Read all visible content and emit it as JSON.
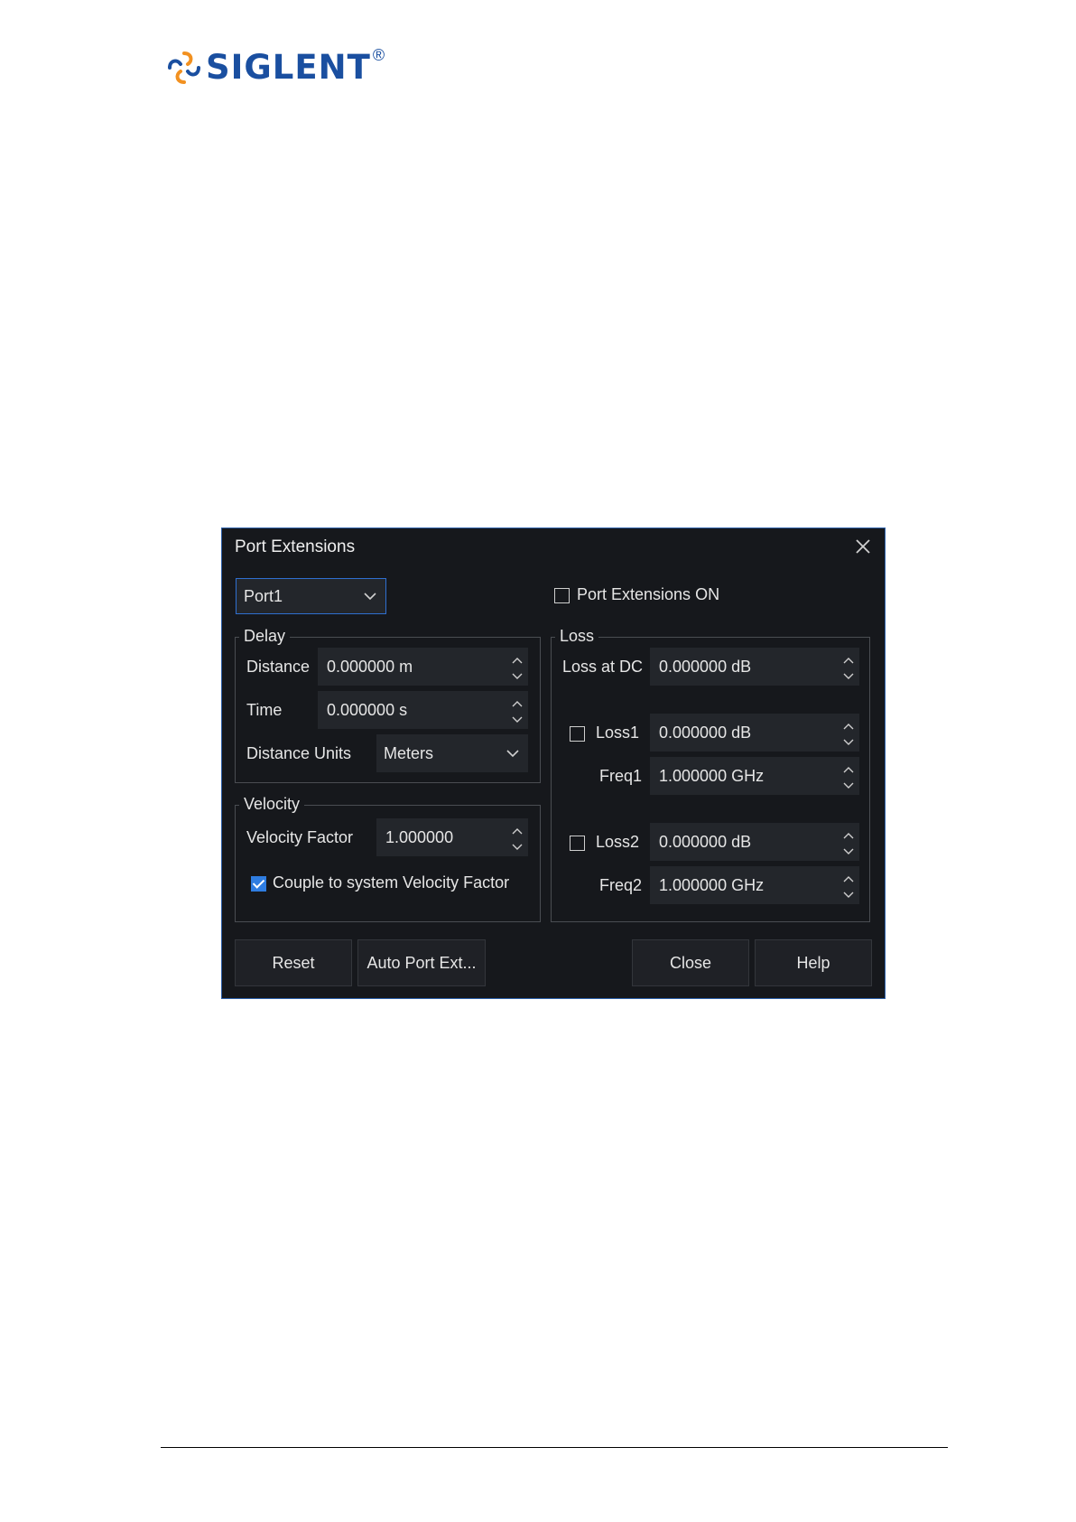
{
  "logo": {
    "text": "SIGLENT",
    "mark": "®"
  },
  "dialog": {
    "title": "Port Extensions",
    "port_select": {
      "value": "Port1"
    },
    "port_ext_on": {
      "label": "Port Extensions ON",
      "checked": false
    },
    "delay": {
      "legend": "Delay",
      "distance": {
        "label": "Distance",
        "value": "0.000000 m"
      },
      "time": {
        "label": "Time",
        "value": "0.000000 s"
      },
      "units": {
        "label": "Distance Units",
        "value": "Meters"
      }
    },
    "velocity": {
      "legend": "Velocity",
      "factor": {
        "label": "Velocity Factor",
        "value": "1.000000"
      },
      "couple": {
        "label": "Couple to system Velocity Factor",
        "checked": true
      }
    },
    "loss": {
      "legend": "Loss",
      "loss_dc": {
        "label": "Loss at DC",
        "value": "0.000000 dB"
      },
      "loss1": {
        "label": "Loss1",
        "value": "0.000000 dB",
        "checked": false
      },
      "freq1": {
        "label": "Freq1",
        "value": "1.000000 GHz"
      },
      "loss2": {
        "label": "Loss2",
        "value": "0.000000 dB",
        "checked": false
      },
      "freq2": {
        "label": "Freq2",
        "value": "1.000000 GHz"
      }
    },
    "buttons": {
      "reset": "Reset",
      "auto": "Auto Port Ext...",
      "close": "Close",
      "help": "Help"
    }
  },
  "colors": {
    "dialog_bg": "#16181c",
    "accent": "#2f7de1",
    "logo_blue": "#1a4fa0",
    "logo_orange": "#f29120"
  }
}
